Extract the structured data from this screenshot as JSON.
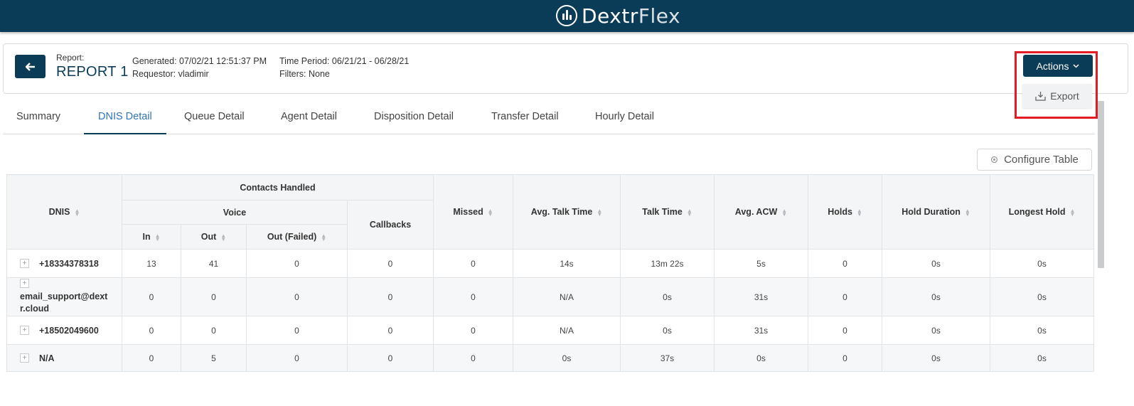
{
  "brand": {
    "name_part1": "Dextr",
    "name_part2": "Flex"
  },
  "report": {
    "label": "Report:",
    "name": "REPORT 1",
    "generated": "Generated: 07/02/21 12:51:37 PM",
    "requestor": "Requestor: vladimir",
    "time_period": "Time Period: 06/21/21 - 06/28/21",
    "filters": "Filters: None"
  },
  "actions": {
    "label": "Actions",
    "menu": [
      {
        "label": "Export",
        "icon": "download-icon"
      }
    ]
  },
  "tabs": [
    {
      "label": "Summary"
    },
    {
      "label": "DNIS Detail",
      "active": true
    },
    {
      "label": "Queue Detail"
    },
    {
      "label": "Agent Detail"
    },
    {
      "label": "Disposition Detail"
    },
    {
      "label": "Transfer Detail"
    },
    {
      "label": "Hourly Detail"
    }
  ],
  "configure_table_label": "Configure Table",
  "table": {
    "headers": {
      "dnis": "DNIS",
      "contacts_handled": "Contacts Handled",
      "voice": "Voice",
      "in": "In",
      "out": "Out",
      "out_failed": "Out (Failed)",
      "callbacks": "Callbacks",
      "missed": "Missed",
      "avg_talk_time": "Avg. Talk Time",
      "talk_time": "Talk Time",
      "avg_acw": "Avg. ACW",
      "holds": "Holds",
      "hold_duration": "Hold Duration",
      "longest_hold": "Longest Hold"
    },
    "rows": [
      {
        "dnis": "+18334378318",
        "in": "13",
        "out": "41",
        "out_failed": "0",
        "callbacks": "0",
        "missed": "0",
        "avg_talk_time": "14s",
        "talk_time": "13m 22s",
        "avg_acw": "5s",
        "holds": "0",
        "hold_duration": "0s",
        "longest_hold": "0s"
      },
      {
        "dnis": "email_support@dextr.cloud",
        "dnis_line1": "email_support@dext",
        "dnis_line2": "r.cloud",
        "in": "0",
        "out": "0",
        "out_failed": "0",
        "callbacks": "0",
        "missed": "0",
        "avg_talk_time": "N/A",
        "talk_time": "0s",
        "avg_acw": "31s",
        "holds": "0",
        "hold_duration": "0s",
        "longest_hold": "0s"
      },
      {
        "dnis": "+18502049600",
        "in": "0",
        "out": "0",
        "out_failed": "0",
        "callbacks": "0",
        "missed": "0",
        "avg_talk_time": "N/A",
        "talk_time": "0s",
        "avg_acw": "31s",
        "holds": "0",
        "hold_duration": "0s",
        "longest_hold": "0s"
      },
      {
        "dnis": "N/A",
        "in": "0",
        "out": "5",
        "out_failed": "0",
        "callbacks": "0",
        "missed": "0",
        "avg_talk_time": "0s",
        "talk_time": "37s",
        "avg_acw": "0s",
        "holds": "0",
        "hold_duration": "0s",
        "longest_hold": "0s"
      }
    ]
  },
  "colors": {
    "brand_navy": "#0b3c57",
    "active_tab": "#2f74b5",
    "highlight_red": "#e31b23"
  }
}
